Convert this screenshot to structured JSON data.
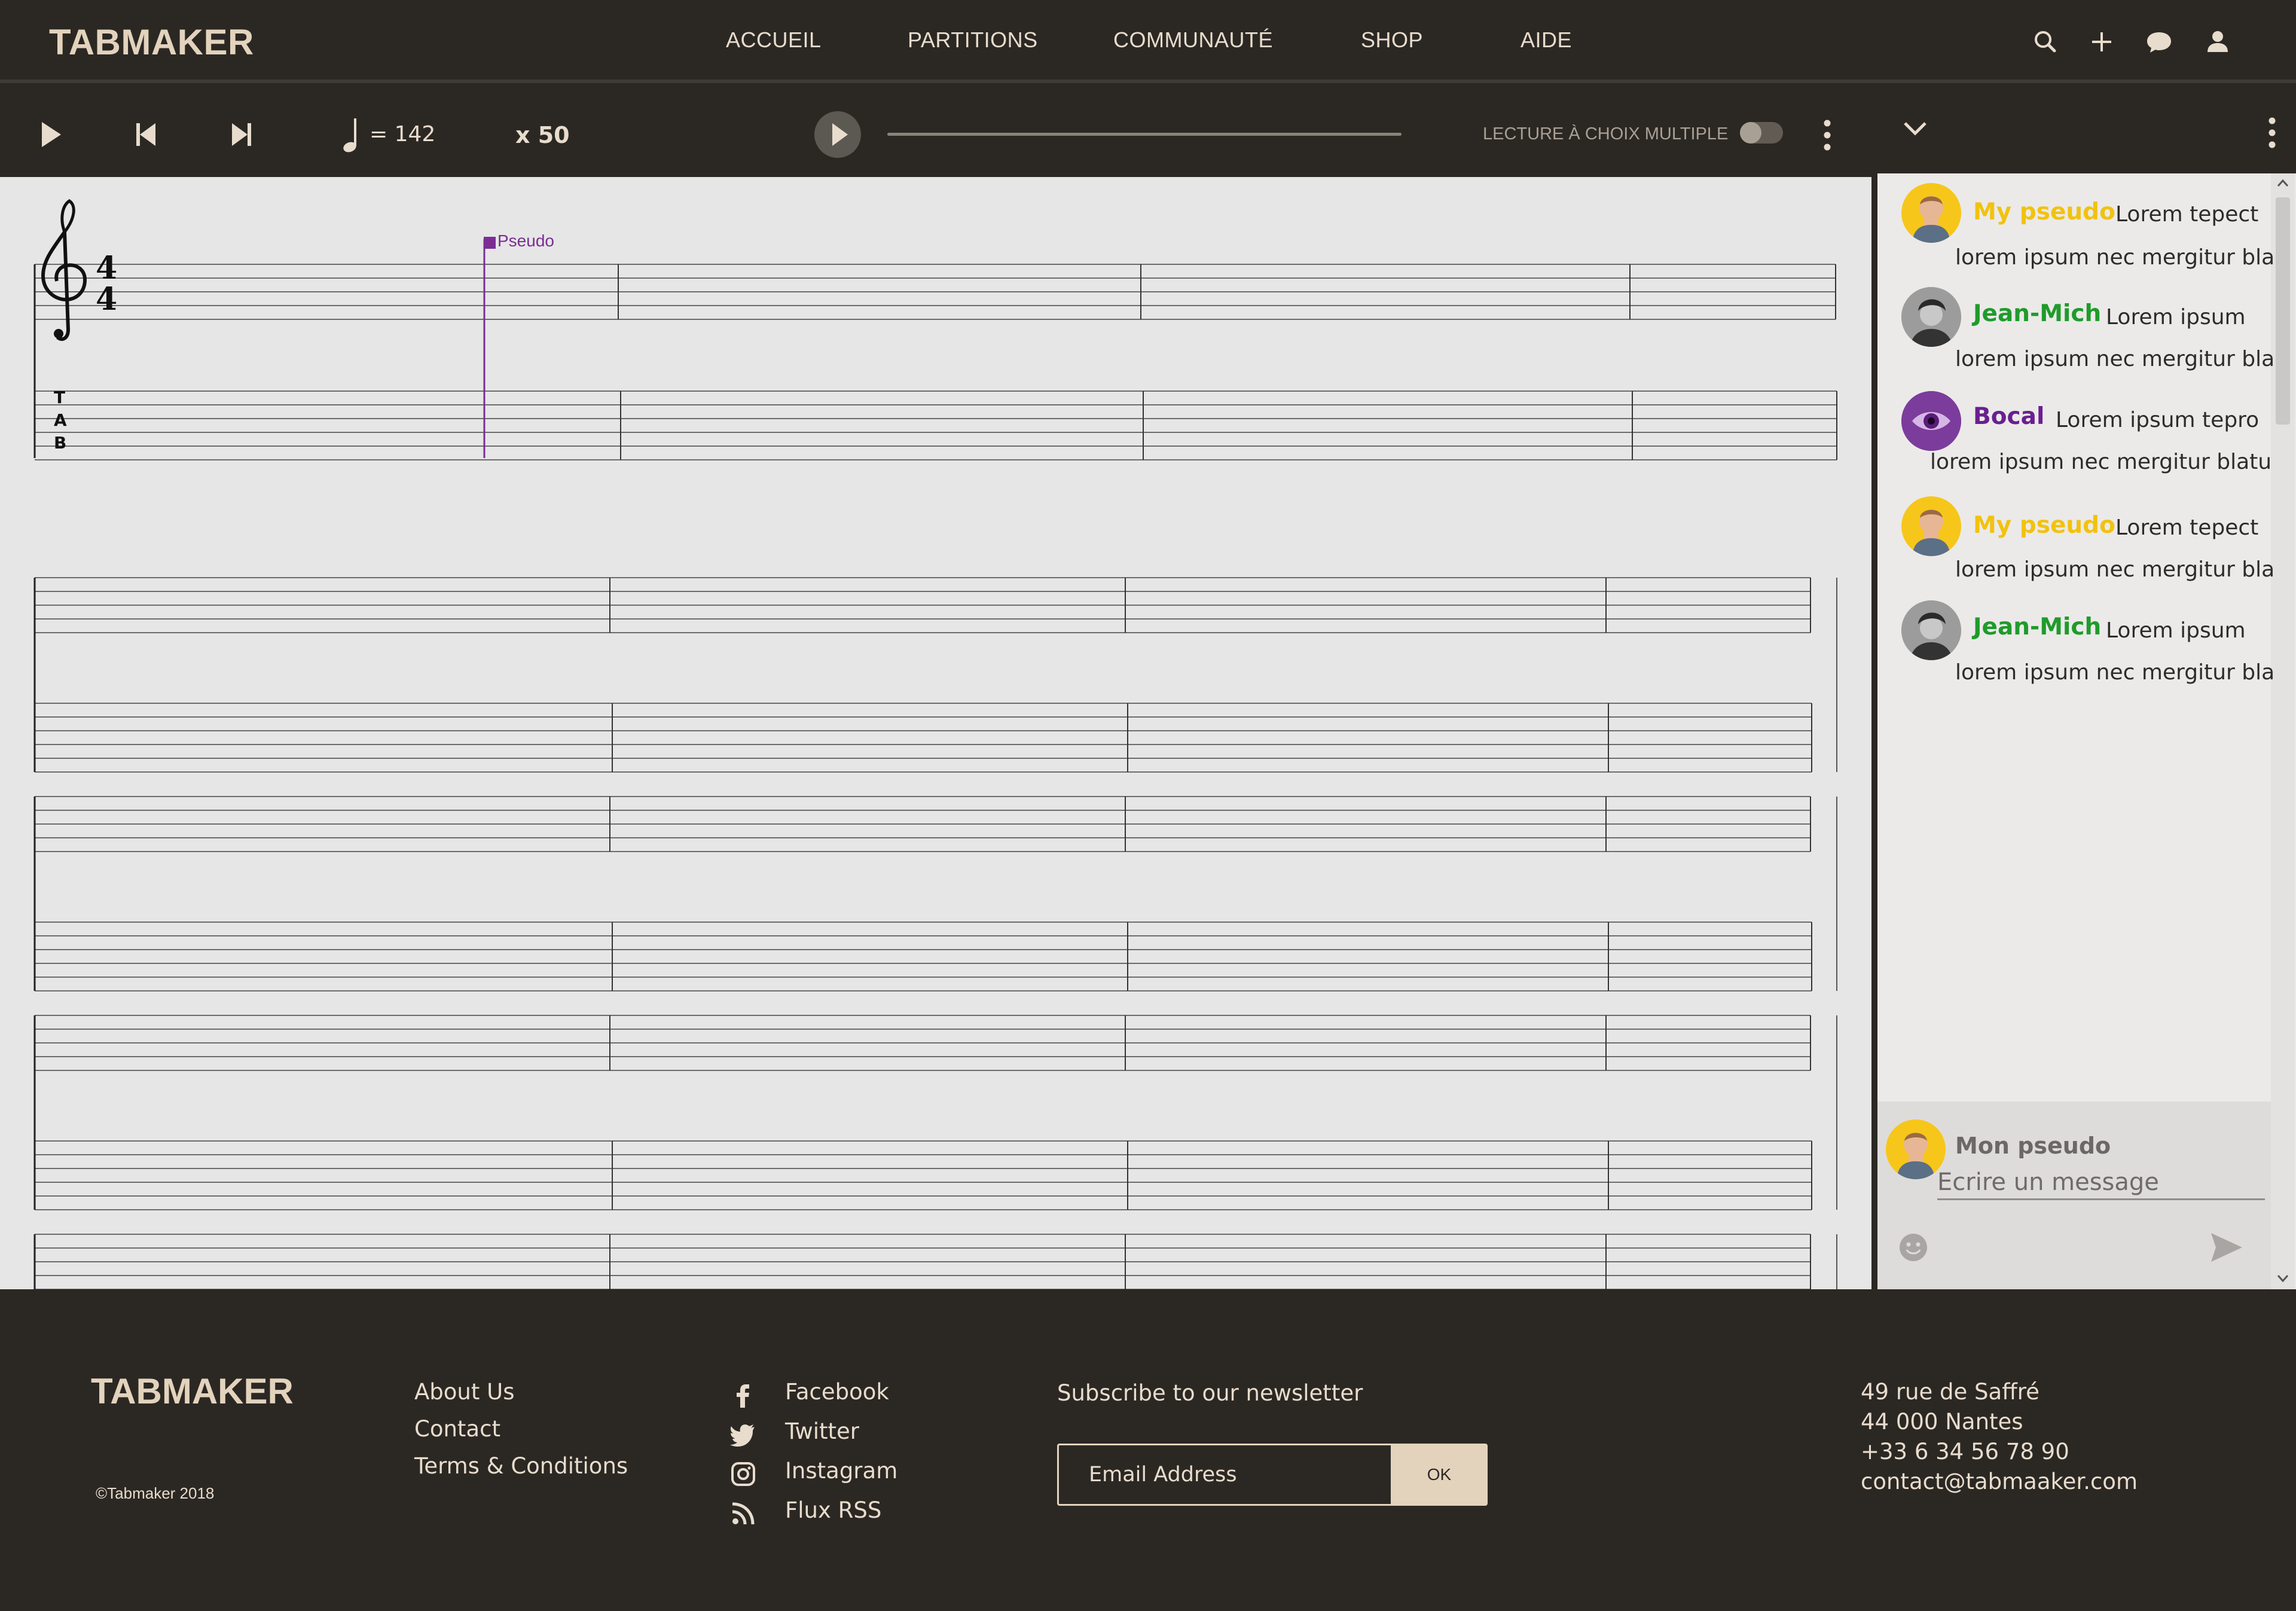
{
  "brand": "TABMAKER",
  "nav": {
    "links": [
      "ACCUEIL",
      "PARTITIONS",
      "COMMUNAUTÉ",
      "SHOP",
      "AIDE"
    ],
    "icons": [
      "search-icon",
      "plus-icon",
      "chat-bubble-icon",
      "user-icon"
    ]
  },
  "player": {
    "tempo": "= 142",
    "speed": "x 50",
    "multiple_choice_label": "LECTURE À CHOIX MULTIPLE",
    "multiple_choice_on": false,
    "progress": 0
  },
  "score": {
    "cursor_label": "Pseudo",
    "time_signature": "4/4",
    "tab_letters": [
      "T",
      "A",
      "B"
    ]
  },
  "chat": {
    "messages": [
      {
        "pseudo": "My pseudo",
        "color": "#f2c20f",
        "preview": "Lorem tepect",
        "text": "lorem ipsum nec mergitur bla"
      },
      {
        "pseudo": "Jean-Mich",
        "color": "#1f9b2b",
        "preview": "Lorem ipsum",
        "text": "lorem ipsum nec mergitur bla"
      },
      {
        "pseudo": "Bocal",
        "color": "#6a1f8f",
        "preview": "Lorem ipsum tepro",
        "text": "lorem ipsum nec mergitur blatu"
      },
      {
        "pseudo": "My pseudo",
        "color": "#f2c20f",
        "preview": "Lorem tepect",
        "text": "lorem ipsum nec mergitur bla"
      },
      {
        "pseudo": "Jean-Mich",
        "color": "#1f9b2b",
        "preview": "Lorem ipsum",
        "text": "lorem ipsum nec mergitur bla"
      }
    ],
    "composer": {
      "name": "Mon pseudo",
      "placeholder": "Ecrire un message"
    }
  },
  "footer": {
    "brand": "TABMAKER",
    "copyright": "©Tabmaker  2018",
    "links": [
      "About Us",
      "Contact",
      "Terms & Conditions"
    ],
    "social": [
      {
        "label": "Facebook",
        "icon": "facebook-icon"
      },
      {
        "label": "Twitter",
        "icon": "twitter-icon"
      },
      {
        "label": "Instagram",
        "icon": "instagram-icon"
      },
      {
        "label": "Flux RSS",
        "icon": "rss-icon"
      }
    ],
    "newsletter": {
      "title": "Subscribe to our newsletter",
      "placeholder": "Email Address",
      "button": "OK"
    },
    "address": [
      "49 rue de Saffré",
      "44 000 Nantes",
      "+33 6 34 56 78 90",
      "contact@tabmaaker.com"
    ]
  },
  "colors": {
    "background": "#2b2824",
    "accent": "#e3d3bd",
    "score_bg": "#e6e6e6",
    "cursor": "#7b2d96"
  }
}
